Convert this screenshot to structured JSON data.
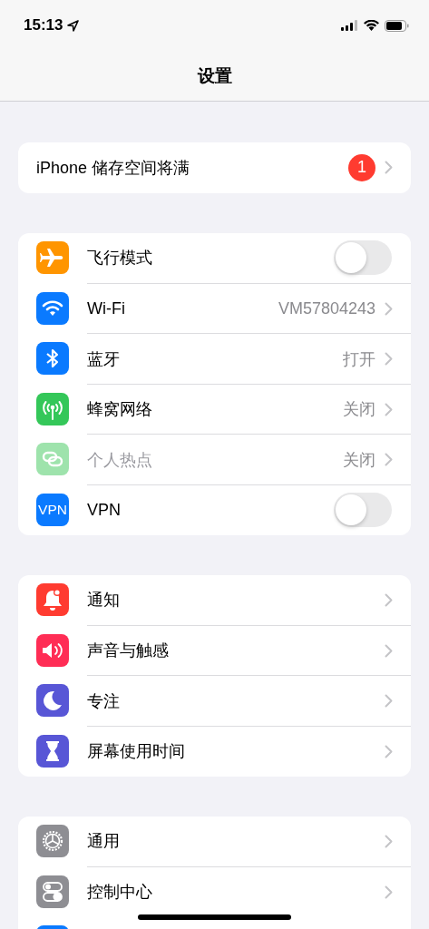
{
  "status_bar": {
    "time": "15:13"
  },
  "nav": {
    "title": "设置"
  },
  "groups": [
    {
      "items": [
        {
          "kind": "alert",
          "label": "iPhone 储存空间将满",
          "badge": "1"
        }
      ]
    },
    {
      "items": [
        {
          "kind": "toggle",
          "label": "飞行模式",
          "color": "#ff9500",
          "on": false
        },
        {
          "kind": "link",
          "label": "Wi-Fi",
          "color": "#0a7aff",
          "value": "VM57804243"
        },
        {
          "kind": "link",
          "label": "蓝牙",
          "color": "#0a7aff",
          "value": "打开"
        },
        {
          "kind": "link",
          "label": "蜂窝网络",
          "color": "#34c759",
          "value": "关闭"
        },
        {
          "kind": "link",
          "label": "个人热点",
          "color": "#9ee3ac",
          "value": "关闭",
          "disabled": true
        },
        {
          "kind": "toggle",
          "label": "VPN",
          "color": "#0a7aff",
          "icon_text": "VPN",
          "on": false
        }
      ]
    },
    {
      "items": [
        {
          "kind": "link",
          "label": "通知",
          "color": "#ff3b30"
        },
        {
          "kind": "link",
          "label": "声音与触感",
          "color": "#ff2d55"
        },
        {
          "kind": "link",
          "label": "专注",
          "color": "#5856d6"
        },
        {
          "kind": "link",
          "label": "屏幕使用时间",
          "color": "#5856d6"
        }
      ]
    },
    {
      "items": [
        {
          "kind": "link",
          "label": "通用",
          "color": "#8e8e93"
        },
        {
          "kind": "link",
          "label": "控制中心",
          "color": "#8e8e93"
        },
        {
          "kind": "partial",
          "color": "#0a7aff"
        }
      ]
    }
  ]
}
